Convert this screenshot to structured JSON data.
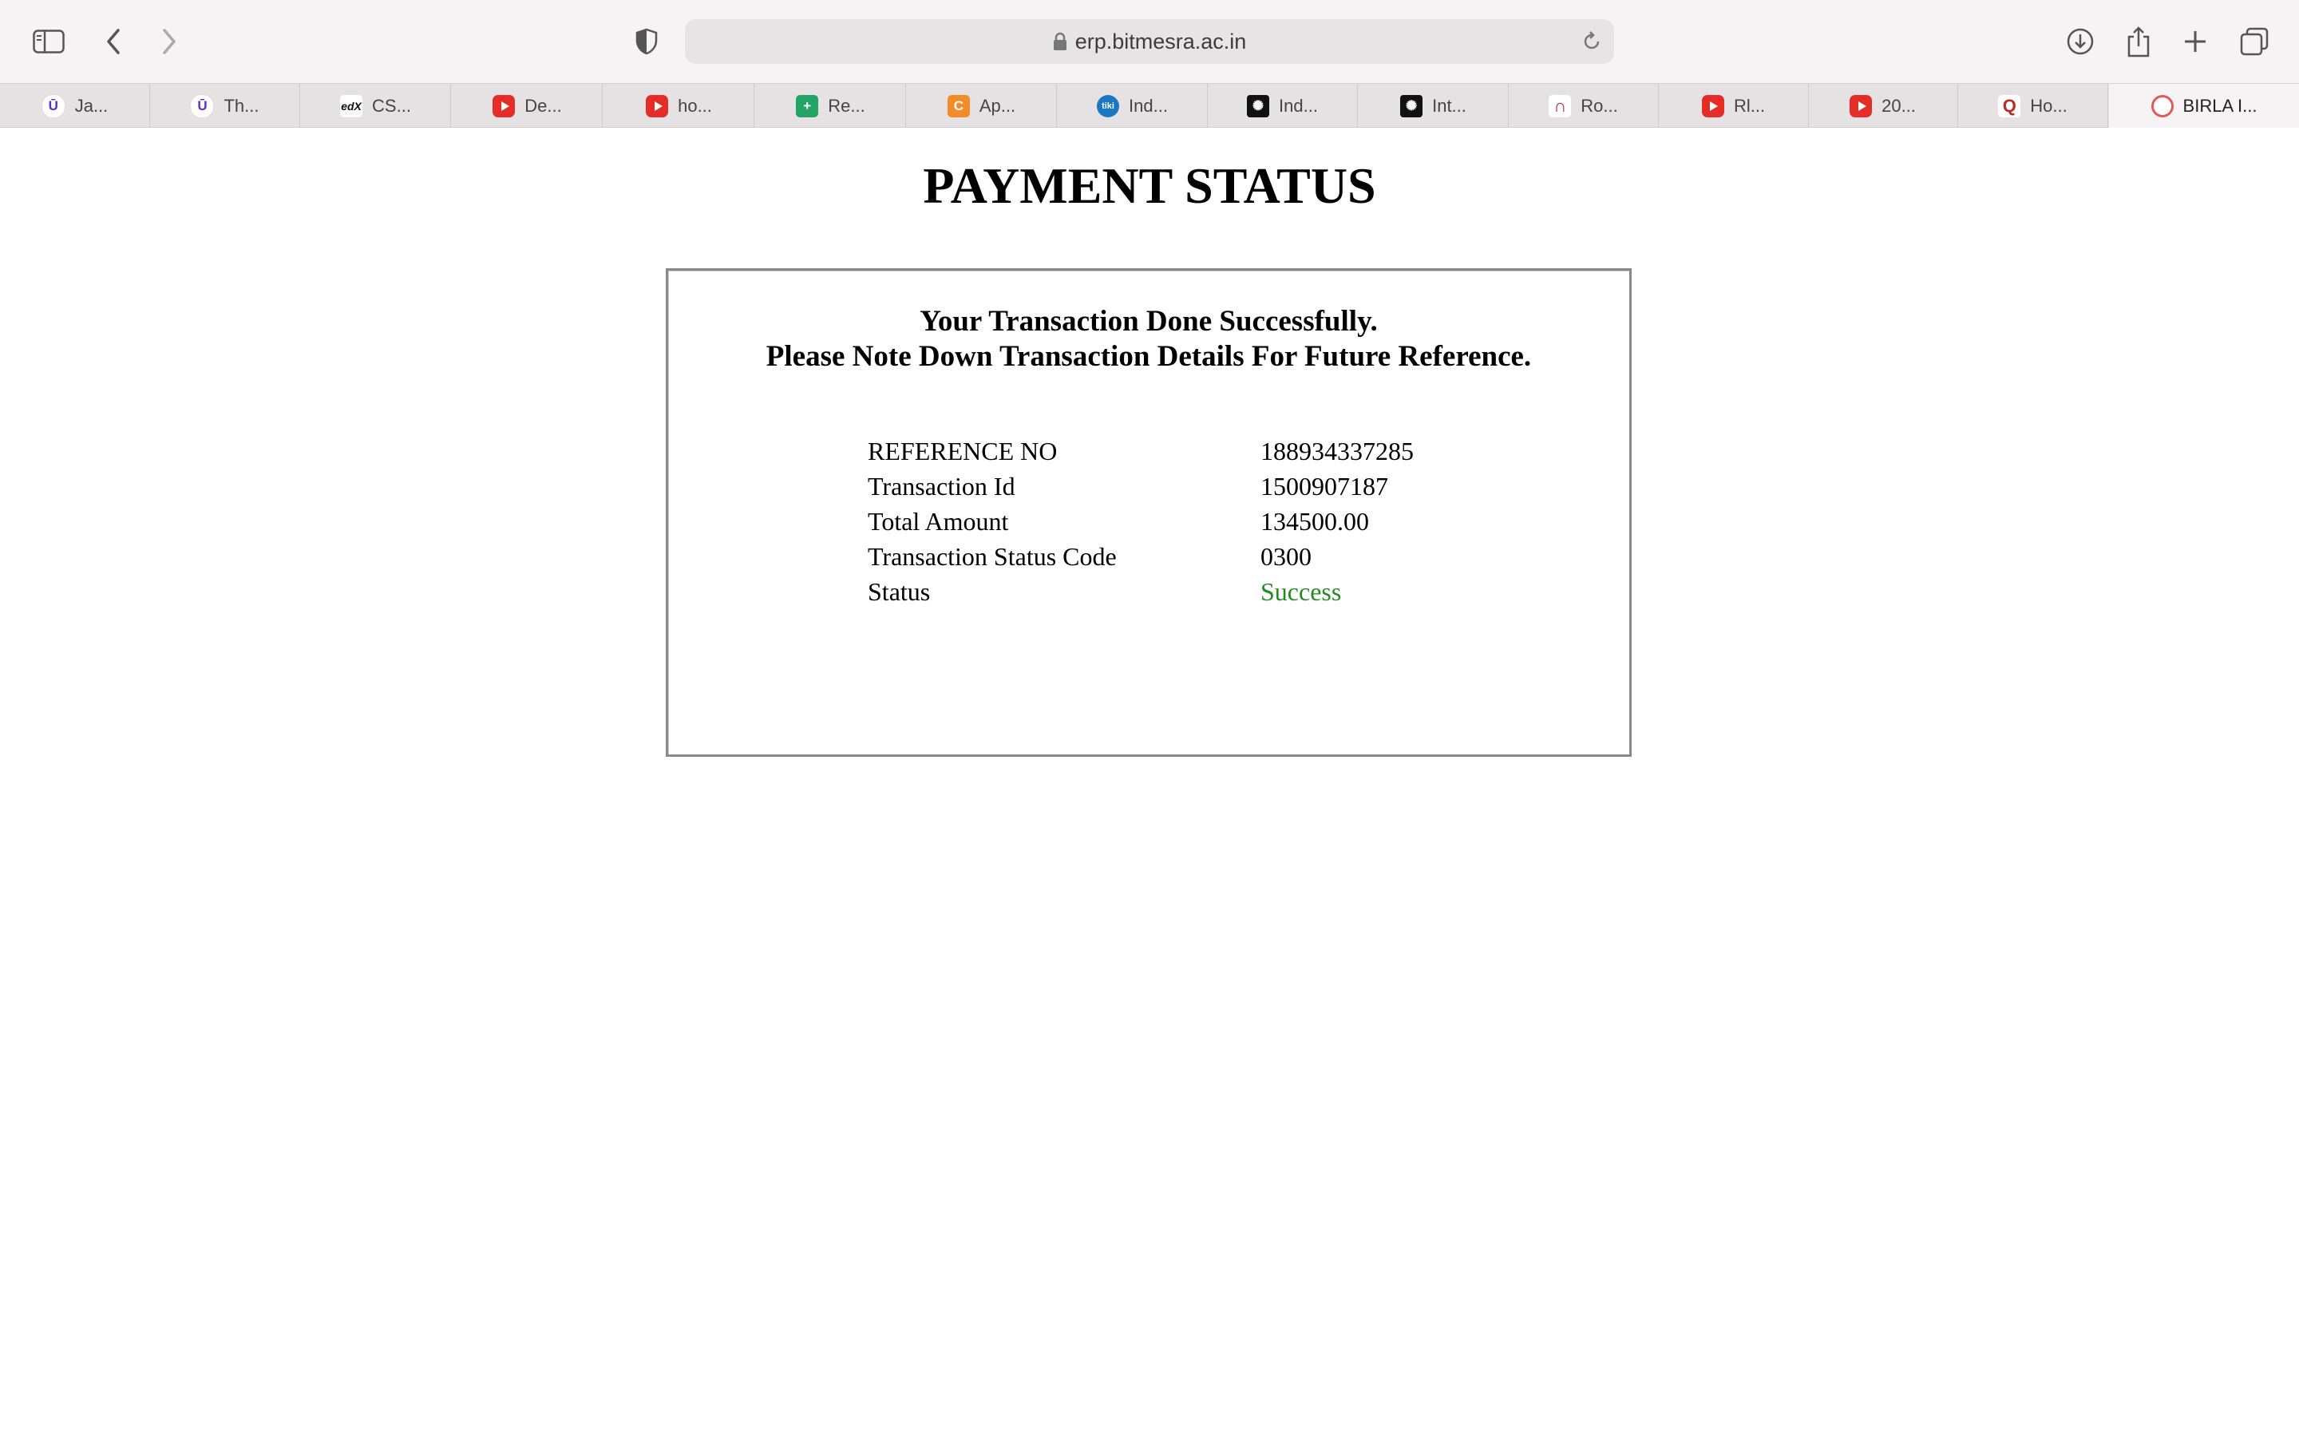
{
  "browser": {
    "url": "erp.bitmesra.ac.in",
    "tabs": [
      {
        "label": "Ja...",
        "icon": "udemy-icon"
      },
      {
        "label": "Th...",
        "icon": "udemy-icon"
      },
      {
        "label": "CS...",
        "icon": "edx-icon"
      },
      {
        "label": "De...",
        "icon": "youtube-icon"
      },
      {
        "label": "ho...",
        "icon": "youtube-icon"
      },
      {
        "label": "Re...",
        "icon": "sheets-icon"
      },
      {
        "label": "Ap...",
        "icon": "c-icon"
      },
      {
        "label": "Ind...",
        "icon": "globe-icon"
      },
      {
        "label": "Ind...",
        "icon": "atom-icon"
      },
      {
        "label": "Int...",
        "icon": "atom-icon"
      },
      {
        "label": "Ro...",
        "icon": "horseshoe-icon"
      },
      {
        "label": "Rl...",
        "icon": "youtube-icon"
      },
      {
        "label": "20...",
        "icon": "youtube-icon"
      },
      {
        "label": "Ho...",
        "icon": "quora-icon"
      },
      {
        "label": "BIRLA I...",
        "icon": "birla-icon",
        "active": true
      }
    ]
  },
  "page": {
    "title": "PAYMENT STATUS",
    "message_line1": "Your Transaction Done Successfully.",
    "message_line2": "Please Note Down Transaction Details For Future Reference.",
    "details": [
      {
        "label": "REFERENCE NO",
        "value": "188934337285"
      },
      {
        "label": "Transaction Id",
        "value": "1500907187"
      },
      {
        "label": "Total Amount",
        "value": "134500.00"
      },
      {
        "label": "Transaction Status Code",
        "value": "0300"
      },
      {
        "label": "Status",
        "value": "Success"
      }
    ],
    "success_color": "#228b22"
  }
}
